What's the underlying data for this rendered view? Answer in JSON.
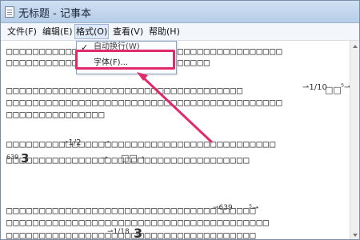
{
  "window": {
    "title": "无标题 - 记事本"
  },
  "menu": {
    "items": [
      {
        "label": "文件(F)"
      },
      {
        "label": "编辑(E)"
      },
      {
        "label": "格式(O)"
      },
      {
        "label": "查看(V)"
      },
      {
        "label": "帮助(H)"
      }
    ]
  },
  "format_menu": {
    "word_wrap_check": "✓",
    "word_wrap_label": "自动换行(W)",
    "font_label": "字体(F)..."
  },
  "editor": {
    "lines": [
      "□□□□□□□□□□□□□□□□□□□□□□□□□□□□□□□□□□□□□□□□□□",
      "□□□□□□□□□□□□□□□□□□□□□□□□□□□□□□□",
      "□□□□□□□□□□□□□□□□□□□□□□□□□□□□□□□□□□□□",
      "□□□□□□□□□□□□□□□□□□□□□□□□□□□□□□□□□□□□□□□□□□",
      "□□□□□□□□□□□□□□□",
      "□□□□□□□□□□□□□□□□□□□□□□□□□□□□□□□□□□□□□□□□□",
      "□□□□□□□□□□□□□□□□□□□□□□□□□□□□□□□□□□□□□",
      "□□□□□□□□□□□□□□□□□□□□□□□□□□□□□□□□□□□□□□",
      "□□□□□□□□□□□□□□□□□□□□□□□□□□□□□□□□□□□□□□□□",
      "□□□□□□□□□□□□□□□□□□□□□□□□□□□□□□□□□□□□□□"
    ],
    "fragments": {
      "f1": "⇀1/10",
      "f2": "□□",
      "f3": "⁵⇀",
      "f4": "⇀1/2",
      "f5": "⇀",
      "f6": "639",
      "f7": "3",
      "f8": "⇀",
      "f9": "□□⇀",
      "f10": "⇀639",
      "f11": "⁵⇀",
      "f12": "⇀1/18",
      "f13": "3"
    }
  },
  "colors": {
    "highlight": "#e02a6d"
  }
}
